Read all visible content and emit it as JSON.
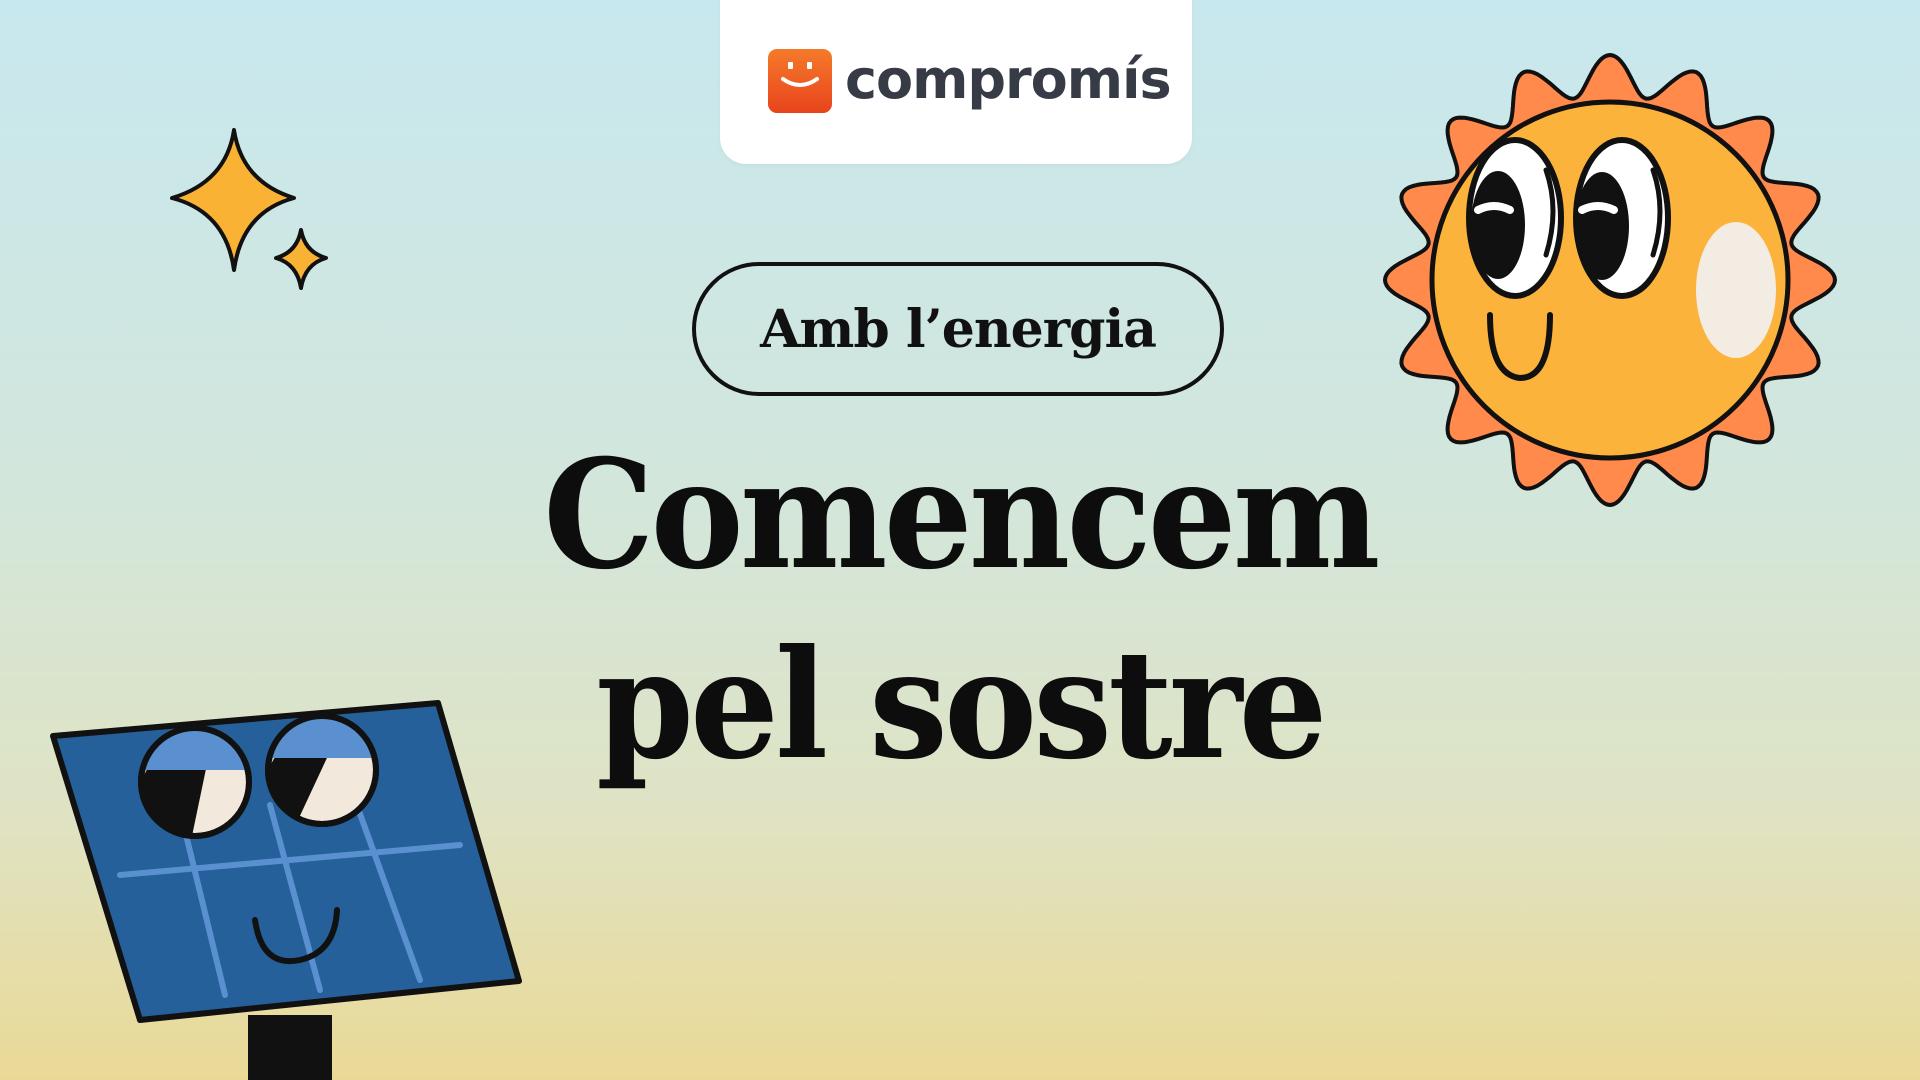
{
  "logo": {
    "icon": "smile-icon",
    "brand_color": "#f05a24",
    "text": "compromís"
  },
  "tagline": "Amb l’energia",
  "headline": {
    "line1": "Comencem",
    "line2": "pel sostre"
  },
  "illustrations": {
    "sparkles": "sparkle-icon",
    "sun": "smiling-sun-icon",
    "panel": "smiling-solar-panel-icon"
  },
  "colors": {
    "sun_rays": "#ff8a4c",
    "sun_body": "#fbb33b",
    "panel_blue": "#25609a",
    "sparkle": "#f9b233",
    "ink": "#111111"
  }
}
